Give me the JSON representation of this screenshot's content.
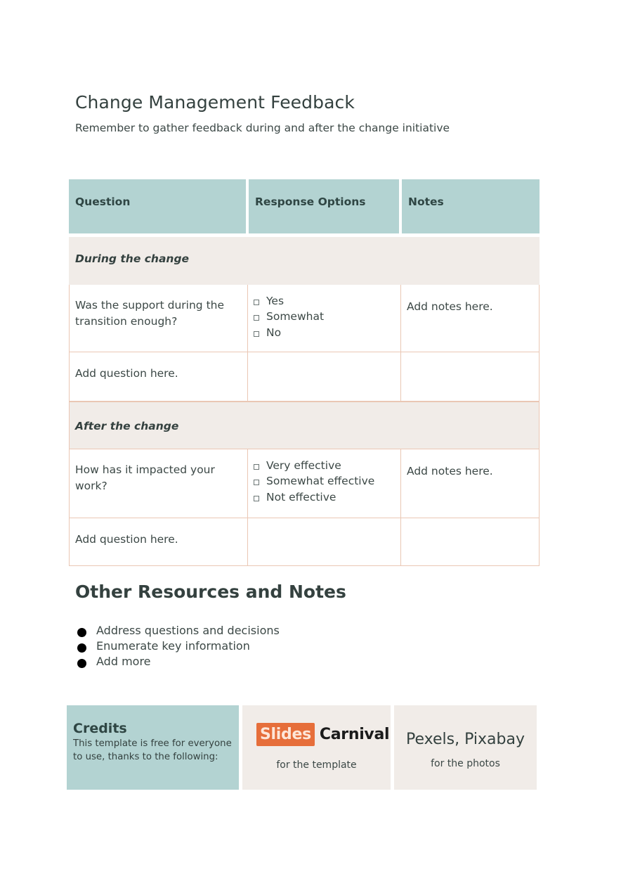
{
  "header": {
    "title": "Change Management Feedback",
    "subtitle": "Remember to gather feedback during and after the change initiative"
  },
  "table": {
    "columns": [
      "Question",
      "Response Options",
      "Notes"
    ],
    "sections": [
      {
        "label": "During the change",
        "rows": [
          {
            "question": "Was the support during the transition enough?",
            "options": [
              "Yes",
              "Somewhat",
              "No"
            ],
            "notes": "Add notes here."
          },
          {
            "question": "Add question here.",
            "options": [],
            "notes": ""
          }
        ]
      },
      {
        "label": "After the change",
        "rows": [
          {
            "question": "How has it impacted your work?",
            "options": [
              "Very effective",
              "Somewhat effective",
              "Not effective"
            ],
            "notes": "Add notes here."
          },
          {
            "question": "Add question here.",
            "options": [],
            "notes": ""
          }
        ]
      }
    ]
  },
  "resources": {
    "title": "Other Resources and Notes",
    "items": [
      "Address questions and decisions",
      "Enumerate key information",
      "Add more"
    ]
  },
  "credits": {
    "title": "Credits",
    "text": "This template is free for everyone to use, thanks to the following:",
    "slidescarnival": {
      "logo_part1": "Slides",
      "logo_part2": "Carnival",
      "caption": "for the template"
    },
    "photos": {
      "name": "Pexels, Pixabay",
      "caption": "for the photos"
    }
  },
  "colors": {
    "header_teal": "#b3d3d2",
    "section_beige": "#f1ece8",
    "border_peach": "#eac7b4",
    "brand_orange": "#e66e3a",
    "text_dark": "#34413f"
  }
}
